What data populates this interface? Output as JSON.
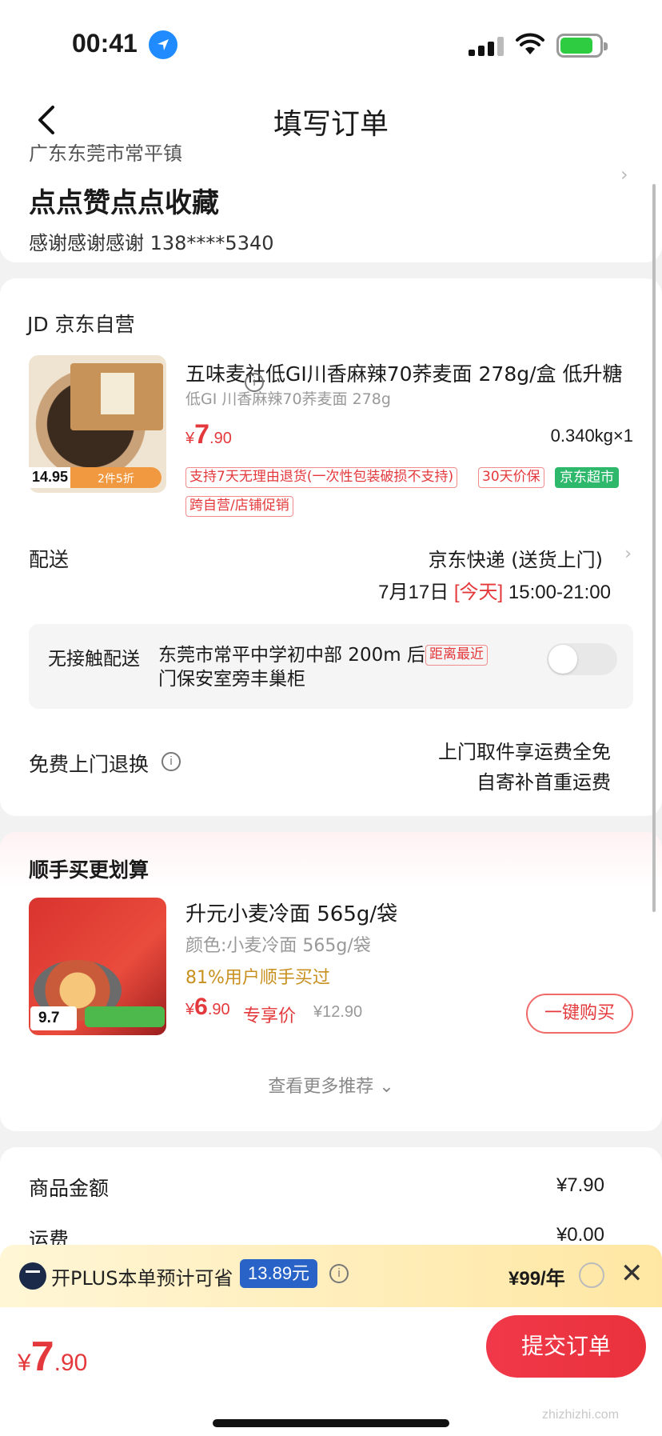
{
  "status_bar": {
    "time": "00:41"
  },
  "nav": {
    "title": "填写订单"
  },
  "address": {
    "region": "广东东莞市常平镇",
    "name": "点点赞点点收藏",
    "contact": "感谢感谢感谢   138****5340"
  },
  "shop": {
    "name": "JD 京东自营",
    "product": {
      "title": "五味麦社低GI川香麻辣70荞麦面 278g/盒 低升糖",
      "subtitle": "低GI 川香麻辣70荞麦面 278g",
      "price_currency": "¥",
      "price_int": "7",
      "price_dec": ".90",
      "qty": "0.340kg×1",
      "thumb_price": "14.95",
      "thumb_promo": "2件5折",
      "tags": [
        "支持7天无理由退货(一次性包装破损不支持)",
        "30天价保",
        "京东超市",
        "跨自营/店铺促销"
      ]
    },
    "delivery": {
      "label": "配送",
      "method": "京东快递 (送货上门)",
      "date": "7月17日",
      "today": "[今天]",
      "slot": "15:00-21:00"
    },
    "contactless": {
      "label": "无接触配送",
      "address": "东莞市常平中学初中部 200m 后门保安室旁丰巢柜",
      "tag": "距离最近"
    },
    "returns": {
      "label": "免费上门退换",
      "line1": "上门取件享运费全免",
      "line2": "自寄补首重运费"
    }
  },
  "recommend": {
    "title": "顺手买更划算",
    "item": {
      "name": "升元小麦冷面 565g/袋",
      "spec": "颜色:小麦冷面 565g/袋",
      "buyers": "81%用户顺手买过",
      "price_currency": "¥",
      "price_int": "6",
      "price_dec": ".90",
      "price_label": "专享价",
      "orig_price": "¥12.90",
      "thumb_price": "9.7",
      "buy_label": "一键购买"
    },
    "see_more": "查看更多推荐 ⌄"
  },
  "summary": {
    "items_label": "商品金额",
    "items_value": "¥7.90",
    "shipping_label": "运费",
    "shipping_value": "¥0.00"
  },
  "plus": {
    "text": "开PLUS本单预计可省",
    "save": "13.89元",
    "price": "¥99/年"
  },
  "bottom": {
    "currency": "¥",
    "total_int": "7",
    "total_dec": ".90",
    "submit": "提交订单",
    "watermark": "zhizhizhi.com"
  },
  "colors": {
    "accent": "#e4393c",
    "green_tag": "#2db86c",
    "plus_blue": "#2a63c8"
  }
}
